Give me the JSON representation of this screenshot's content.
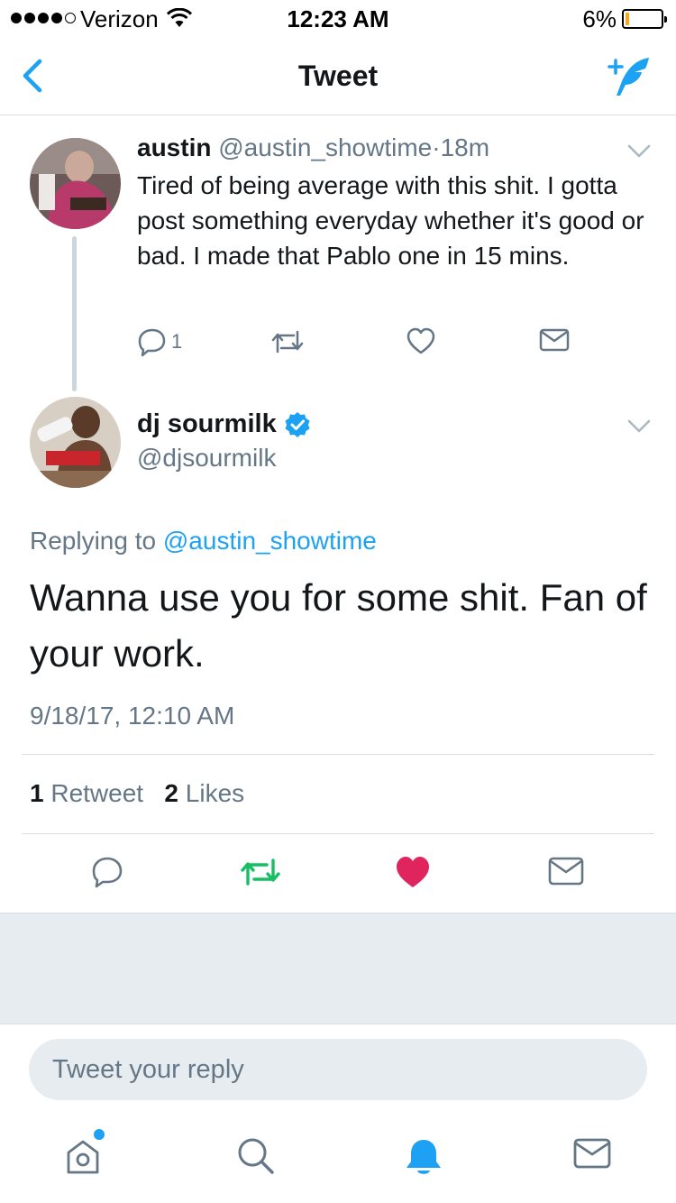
{
  "status_bar": {
    "carrier": "Verizon",
    "time": "12:23 AM",
    "battery_percent": "6%",
    "battery_level": 0.06
  },
  "nav": {
    "title": "Tweet",
    "back_icon": "chevron-left-icon",
    "compose_icon": "compose-tweet-icon"
  },
  "parent_tweet": {
    "name": "austin",
    "handle": "@austin_showtime",
    "separator": "·",
    "age": "18m",
    "text": "Tired of being average with this shit. I gotta post something everyday whether it's good or bad. I made that Pablo one in 15 mins.",
    "reply_count": "1",
    "icons": [
      "reply-icon",
      "retweet-icon",
      "like-icon",
      "message-icon"
    ]
  },
  "main_tweet": {
    "name": "dj sourmilk",
    "verified": true,
    "handle": "@djsourmilk",
    "replying_label": "Replying to",
    "replying_to": "@austin_showtime",
    "text": "Wanna use you for some shit. Fan of your work.",
    "timestamp": "9/18/17, 12:10 AM",
    "retweet_count": "1",
    "retweet_label": "Retweet",
    "like_count": "2",
    "like_label": "Likes",
    "liked": true,
    "colors": {
      "retweet": "#17bf63",
      "like": "#e0245e"
    }
  },
  "reply_bar": {
    "placeholder": "Tweet your reply"
  },
  "tab_bar": {
    "items": [
      "home-icon",
      "search-icon",
      "notifications-icon",
      "messages-icon"
    ],
    "active": "notifications-icon",
    "home_has_dot": true
  },
  "colors": {
    "accent": "#1da1f2",
    "secondary_text": "#657786",
    "divider": "#d8dde1"
  }
}
